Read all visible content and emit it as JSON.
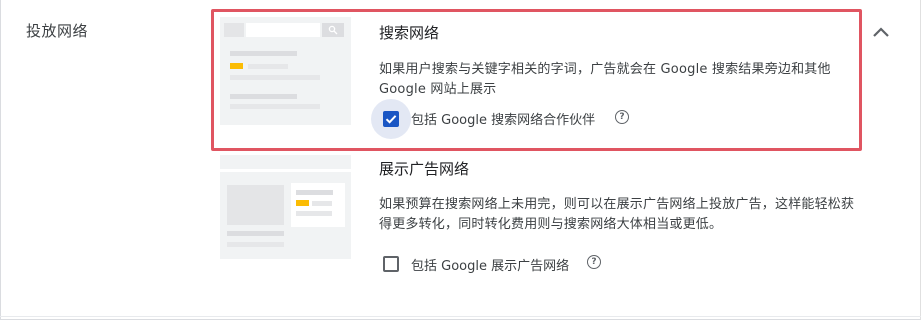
{
  "section": {
    "label": "投放网络"
  },
  "search_network": {
    "title": "搜索网络",
    "description": "如果用户搜索与关键字相关的字词，广告就会在 Google 搜索结果旁边和其他 Google 网站上展示",
    "checkbox_label": "包括 Google 搜索网络合作伙伴",
    "checked": true,
    "highlighted": true
  },
  "display_network": {
    "title": "展示广告网络",
    "description": "如果预算在搜索网络上未用完，则可以在展示广告网络上投放广告，这样能轻松获得更多转化，同时转化费用则与搜索网络大体相当或更低。",
    "checkbox_label": "包括 Google 展示广告网络",
    "checked": false
  },
  "icons": {
    "collapse": "chevron-up-icon",
    "help": "help-circle-icon",
    "check": "check-icon"
  },
  "colors": {
    "highlight_border": "#e05561",
    "checkbox_checked": "#1a56c4",
    "accent_yellow": "#fbbc04"
  }
}
